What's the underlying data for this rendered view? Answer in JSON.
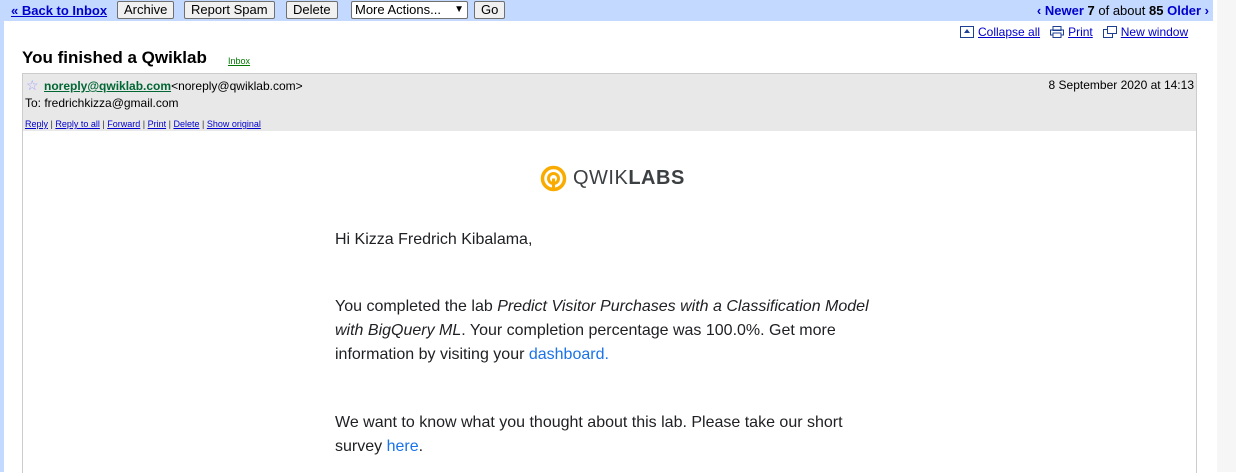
{
  "toolbar": {
    "back_label": "« Back to Inbox",
    "archive_label": "Archive",
    "spam_label": "Report Spam",
    "delete_label": "Delete",
    "more_actions": "More Actions...",
    "go_label": "Go",
    "newer_label": "‹ Newer",
    "position": "7",
    "of_about": "of about",
    "total": "85",
    "older_label": "Older ›"
  },
  "subtools": {
    "collapse_all": "Collapse all",
    "print": "Print",
    "new_window": "New window"
  },
  "message": {
    "subject": "You finished a Qwiklab",
    "label": "Inbox",
    "from_address": "noreply@qwiklab.com",
    "from_full": "<noreply@qwiklab.com>",
    "to_line": "To: fredrichkizza@gmail.com",
    "date": "8 September 2020 at 14:13",
    "actions": [
      "Reply",
      "Reply to all",
      "Forward",
      "Print",
      "Delete",
      "Show original"
    ]
  },
  "email": {
    "logo_light": "QWIK",
    "logo_bold": "LABS",
    "greeting": "Hi Kizza Fredrich Kibalama,",
    "p1_start": "You completed the lab ",
    "p1_lab": "Predict Visitor Purchases with a Classification Model with BigQuery ML",
    "p1_mid": ". Your completion percentage was 100.0%. Get more information by visiting your ",
    "p1_link": "dashboard",
    "p1_end": ".",
    "p2_start": "We want to know what you thought about this lab. Please take our short survey ",
    "p2_link": "here",
    "p2_end": "."
  },
  "colors": {
    "toolbar_bg": "#c3d9ff",
    "header_bg": "#e8e8e8",
    "logo_yellow": "#f9ab00",
    "link_blue": "#1a73e8"
  }
}
